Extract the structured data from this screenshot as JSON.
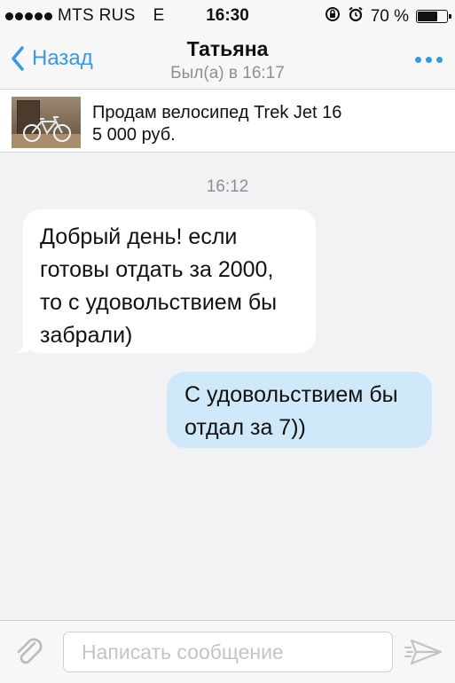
{
  "status_bar": {
    "carrier": "MTS RUS",
    "network": "E",
    "time": "16:30",
    "battery_percent": "70 %",
    "battery_level": 0.7,
    "icons": [
      "rotation-lock-icon",
      "alarm-icon"
    ]
  },
  "nav": {
    "back_label": "Назад",
    "title": "Татьяна",
    "subtitle": "Был(а) в 16:17"
  },
  "listing": {
    "title": "Продам велосипед Trek Jet 16",
    "price": "5 000 руб."
  },
  "chat": {
    "timestamp": "16:12",
    "messages": [
      {
        "direction": "incoming",
        "lines": [
          "Добрый день! если",
          "готовы отдать за 2000,",
          "то с удовольствием бы",
          "забрали)"
        ]
      },
      {
        "direction": "outgoing",
        "lines": [
          "С удовольствием бы",
          "отдал за 7))"
        ]
      }
    ]
  },
  "composer": {
    "placeholder": "Написать сообщение",
    "value": ""
  },
  "colors": {
    "accent": "#3a9ad9",
    "outgoing_bubble": "#cfe9fb",
    "incoming_bubble": "#ffffff",
    "background": "#f2f2f4"
  }
}
